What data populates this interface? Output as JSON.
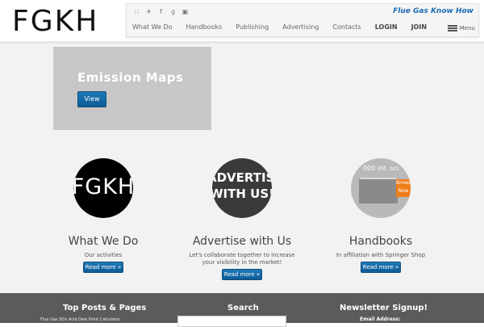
{
  "header": {
    "logo": "FGKH",
    "tagline": "Flue Gas Know How",
    "social_icons": [
      "rss-icon",
      "twitter-icon",
      "facebook-icon",
      "google-plus-icon",
      "linkedin-icon"
    ],
    "nav": [
      "What We Do",
      "Handbooks",
      "Publishing",
      "Advertising",
      "Contacts",
      "LOGIN",
      "JOIN"
    ],
    "menu_label": "Menu"
  },
  "hero": {
    "title": "Emission Maps",
    "button": "View"
  },
  "features": [
    {
      "image_text": "FGKH",
      "title": "What We Do",
      "text": "Our activities",
      "button": "Read more »"
    },
    {
      "image_text": "ADVERTISE WITH US!",
      "title": "Advertise with Us",
      "text": "Let's collaborate together to increase your visibility in the market!",
      "button": "Read more »"
    },
    {
      "image_text": "000 int. sci",
      "image_badge": "Browse Now",
      "title": "Handbooks",
      "text": "In affiliation with Springer Shop",
      "button": "Read more »"
    }
  ],
  "footer": {
    "col1_title": "Top Posts & Pages",
    "col1_link": "Flue Gas SOx Acid Dew Point Calculator",
    "col2_title": "Search",
    "col3_title": "Newsletter Signup!",
    "email_label": "Email Address:"
  },
  "colors": {
    "accent": "#1d6bb3",
    "button": "#1a6ea8",
    "footer": "#5b5b5b"
  }
}
